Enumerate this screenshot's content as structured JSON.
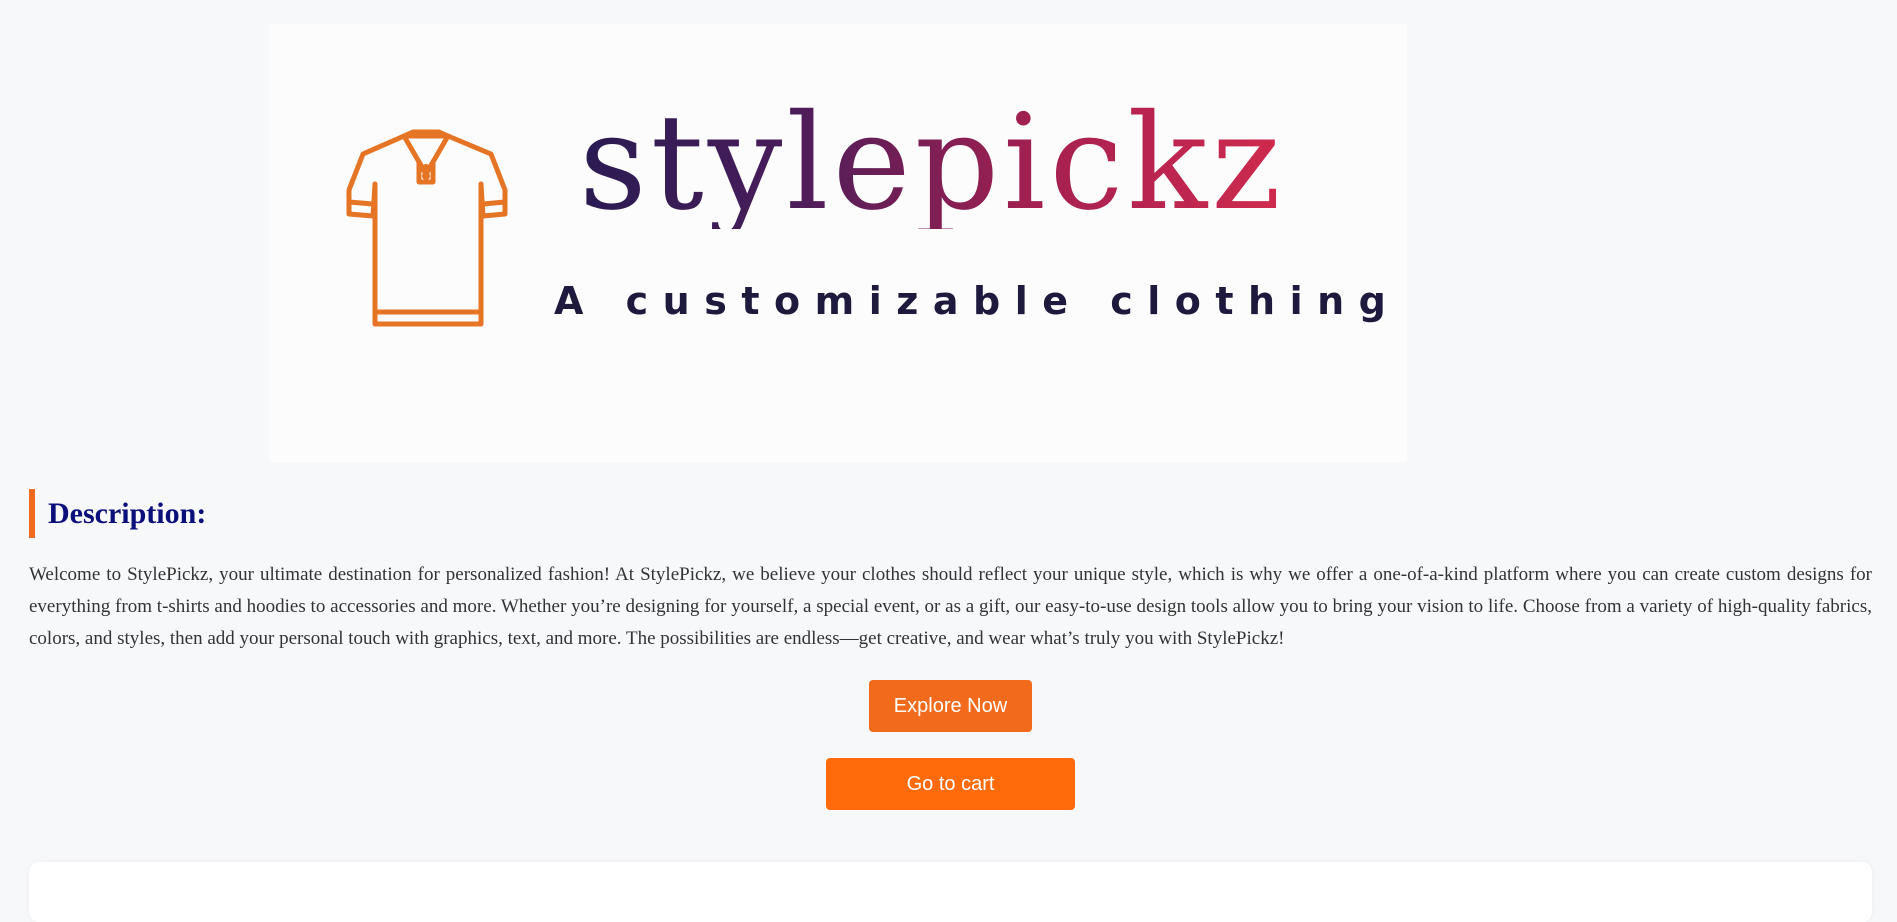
{
  "banner": {
    "brand": "stylepickz",
    "tagline": "A customizable clothing",
    "shirt_icon": "polo-shirt-icon",
    "shirt_color": "#e57425"
  },
  "description": {
    "heading": "Description:",
    "text": "Welcome to StylePickz, your ultimate destination for personalized fashion! At StylePickz, we believe your clothes should reflect your unique style, which is why we offer a one-of-a-kind platform where you can create custom designs for everything from t-shirts and hoodies to accessories and more. Whether you’re designing for yourself, a special event, or as a gift, our easy-to-use design tools allow you to bring your vision to life. Choose from a variety of high-quality fabrics, colors, and styles, then add your personal touch with graphics, text, and more. The possibilities are endless—get creative, and wear what’s truly you with StylePickz!"
  },
  "actions": {
    "explore_label": "Explore Now",
    "cart_label": "Go to cart"
  },
  "colors": {
    "accent": "#f26b1d",
    "heading": "#0b0f7a",
    "background": "#f7f8fa"
  }
}
